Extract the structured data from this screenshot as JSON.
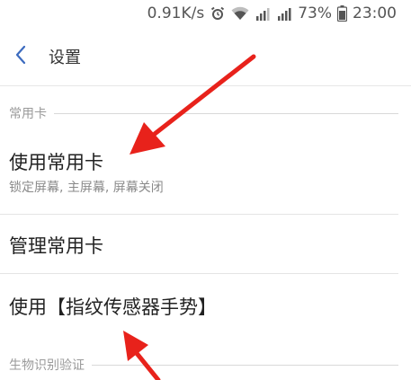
{
  "status_bar": {
    "network_speed": "0.91K/s",
    "alarm_icon": "alarm-clock-icon",
    "wifi_icon": "wifi-icon",
    "signal_icon_1": "signal-3g-icon",
    "signal_icon_2": "signal-4g-icon",
    "battery_percent": "73%",
    "battery_icon": "battery-icon",
    "time": "23:00"
  },
  "header": {
    "back_icon": "chevron-left-icon",
    "title": "设置"
  },
  "sections": {
    "common_card": {
      "label": "常用卡",
      "items": {
        "use_card": {
          "title": "使用常用卡",
          "subtitle": "锁定屏幕, 主屏幕, 屏幕关闭"
        },
        "manage_card": {
          "title": "管理常用卡"
        },
        "use_gesture": {
          "title": "使用【指纹传感器手势】"
        }
      }
    },
    "biometric": {
      "label": "生物识别验证"
    }
  },
  "annotations": {
    "arrow_color": "#e8221b"
  },
  "colors": {
    "accent": "#3c6bbf",
    "section_text": "#9a9a9a"
  }
}
